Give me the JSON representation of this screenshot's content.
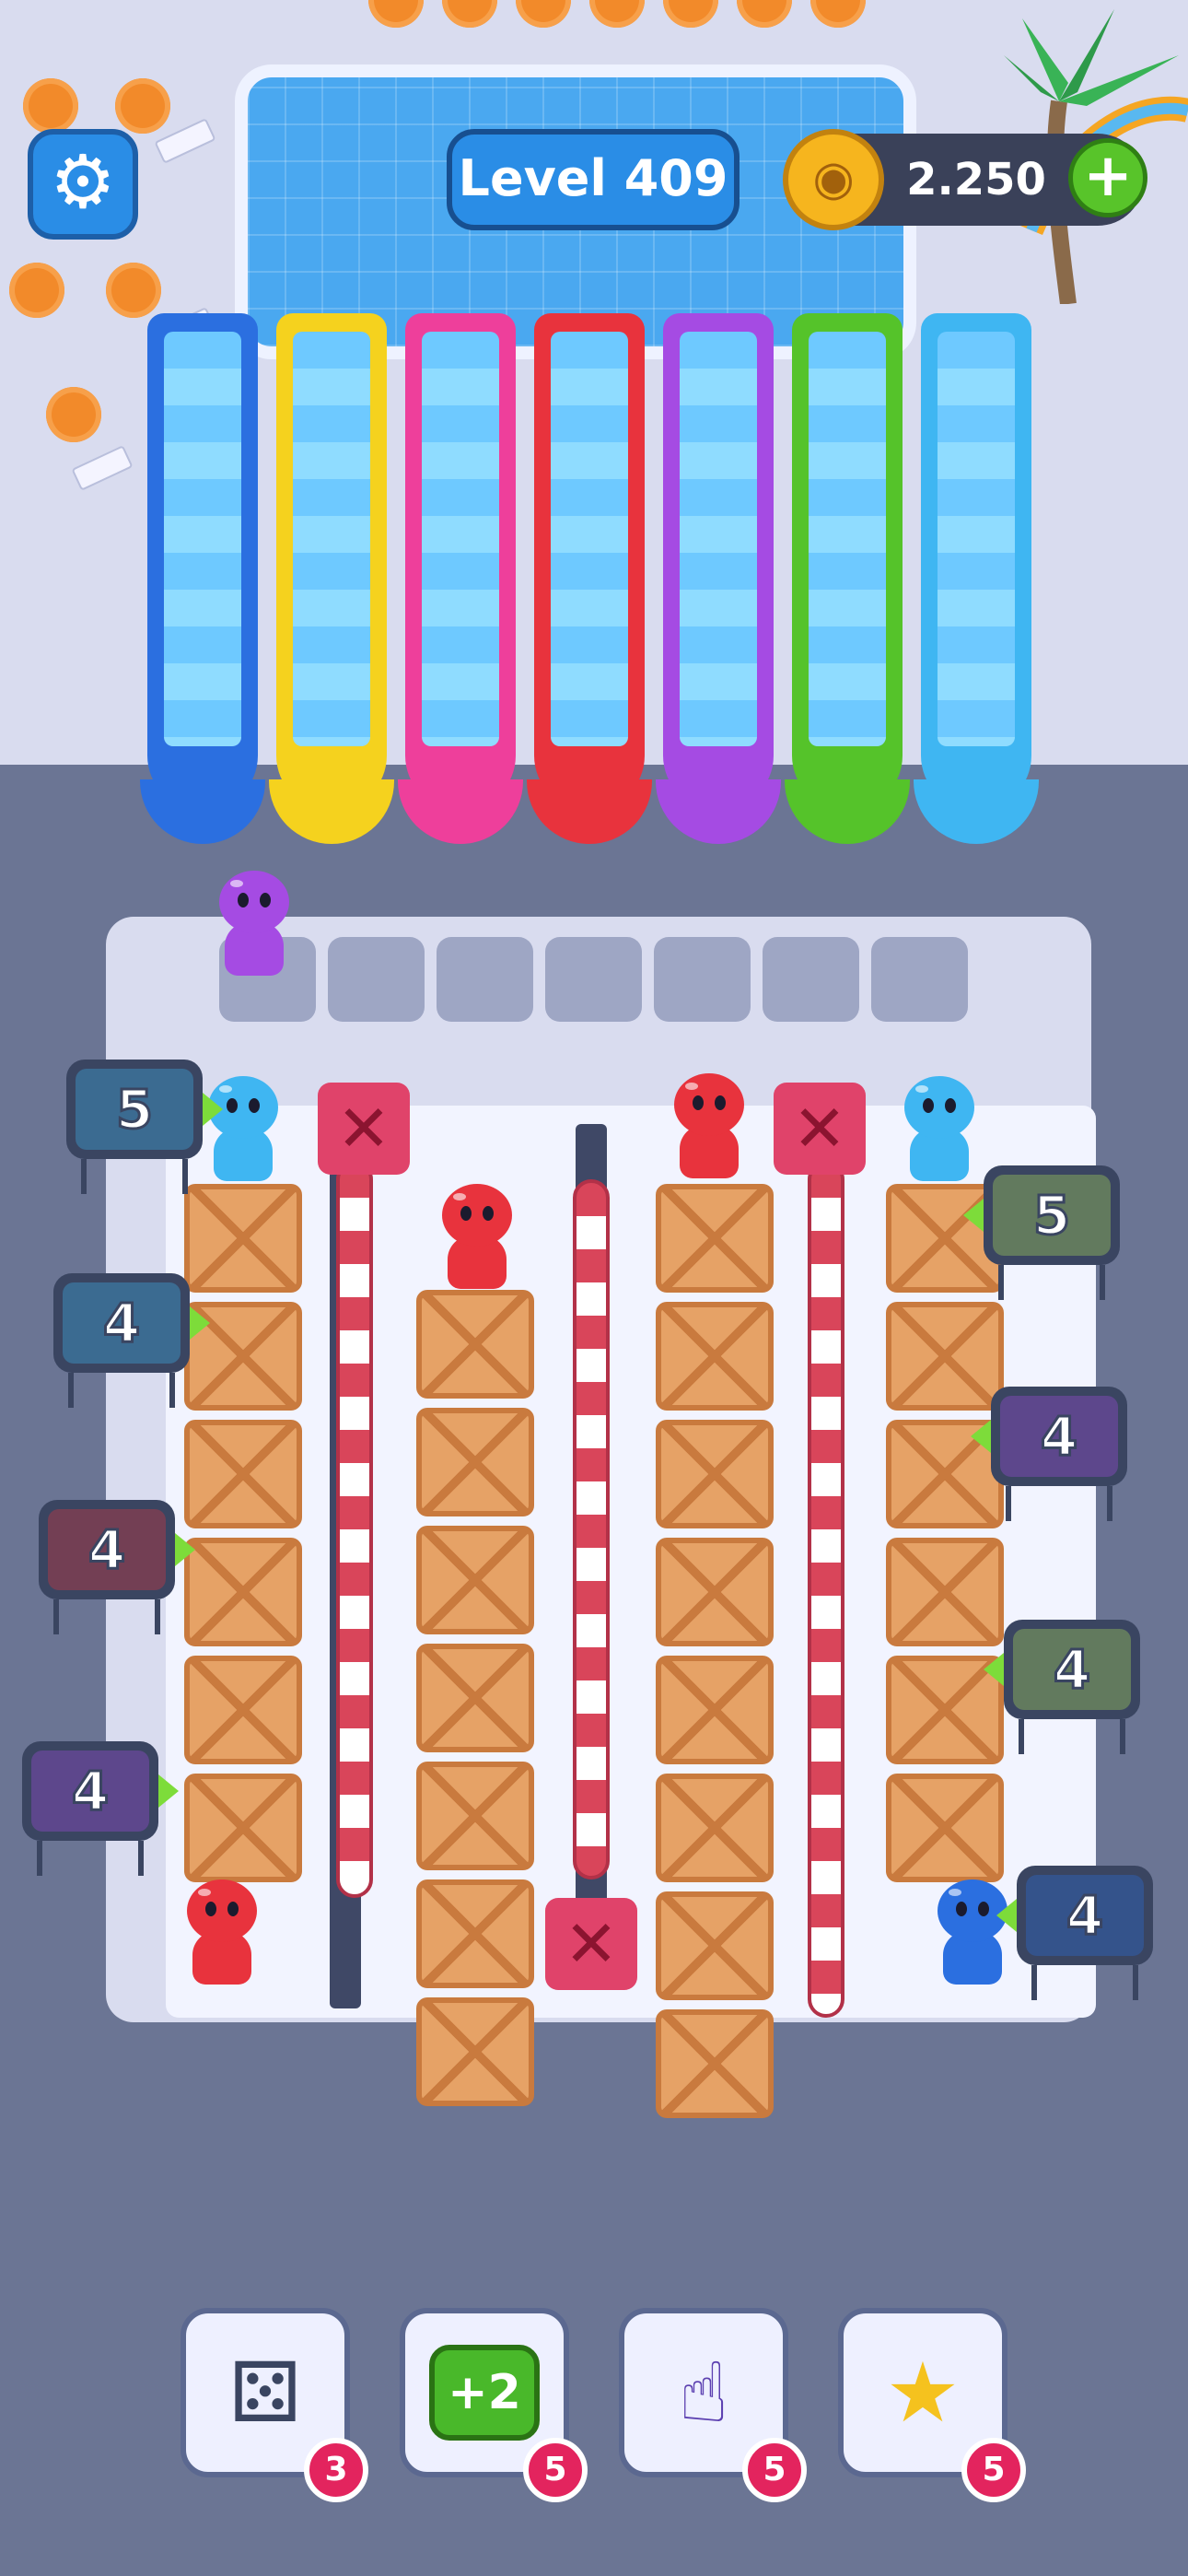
{
  "hud": {
    "level_label": "Level 409",
    "coins": "2.250",
    "add_coins_symbol": "+",
    "settings_icon": "gear-icon"
  },
  "slides": [
    {
      "color": "#2b6fe0",
      "name": "blue"
    },
    {
      "color": "#f5d21e",
      "name": "yellow"
    },
    {
      "color": "#ee3f9b",
      "name": "pink"
    },
    {
      "color": "#e8333d",
      "name": "red"
    },
    {
      "color": "#a54be3",
      "name": "purple"
    },
    {
      "color": "#55c32a",
      "name": "green"
    },
    {
      "color": "#3fb6f2",
      "name": "light-blue"
    }
  ],
  "queue": {
    "waiting_character": {
      "color": "#a54be3"
    },
    "empty_slots": 7
  },
  "board": {
    "blocked_marker": "✕",
    "left_boxes": [
      {
        "count": "5",
        "color": "#3fb6f2"
      },
      {
        "count": "4",
        "color": "#3fb6f2"
      },
      {
        "count": "4",
        "color": "#e8333d"
      },
      {
        "count": "4",
        "color": "#a54be3"
      }
    ],
    "right_boxes": [
      {
        "count": "5",
        "color": "#b5e35a"
      },
      {
        "count": "4",
        "color": "#a54be3"
      },
      {
        "count": "4",
        "color": "#b5e35a"
      },
      {
        "count": "4",
        "color": "#2b6fe0"
      }
    ],
    "characters": [
      {
        "color": "#3fb6f2"
      },
      {
        "color": "#e8333d"
      },
      {
        "color": "#e8333d"
      },
      {
        "color": "#3fb6f2"
      },
      {
        "color": "#e8333d"
      },
      {
        "color": "#2b6fe0"
      }
    ]
  },
  "boosters": [
    {
      "name": "dice",
      "icon": "dice-icon",
      "count": "3"
    },
    {
      "name": "plus-two",
      "icon": "plus-two-icon",
      "label": "+2",
      "count": "5"
    },
    {
      "name": "pick-character",
      "icon": "hand-pick-icon",
      "count": "5"
    },
    {
      "name": "magic-wand",
      "icon": "magic-wand-icon",
      "count": "5"
    }
  ]
}
